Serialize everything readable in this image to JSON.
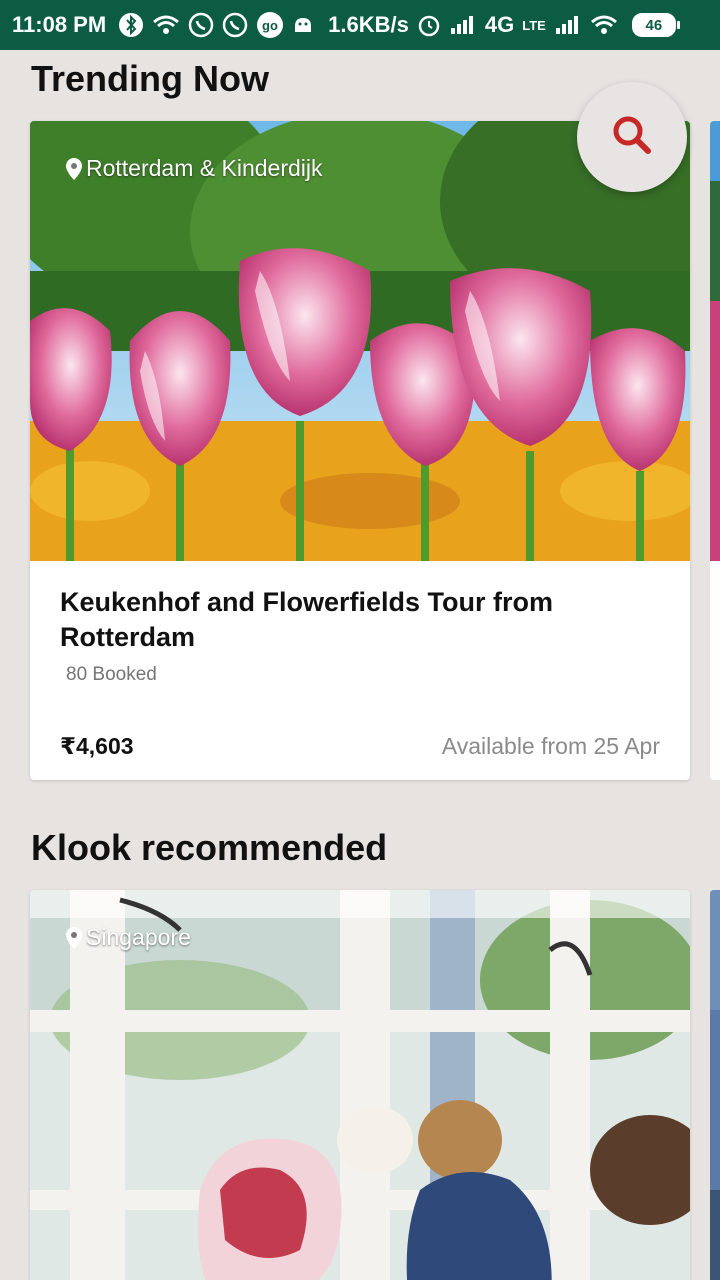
{
  "status_bar": {
    "time": "11:08 PM",
    "speed": "1.6KB/s",
    "network": "4G",
    "volte": "LTE",
    "battery": "46",
    "icons": [
      "bluetooth-icon",
      "wifi-icon",
      "whatsapp-icon",
      "whatsapp-icon",
      "go-icon",
      "android-icon",
      "alarm-icon",
      "signal-icon",
      "signal-icon",
      "wifi-icon"
    ]
  },
  "fab": {
    "icon": "search-icon",
    "color": "#c62828"
  },
  "sections": {
    "trending": {
      "title": "Trending Now",
      "card": {
        "location": "Rotterdam & Kinderdijk",
        "title": "Keukenhof and Flowerfields Tour from Rotterdam",
        "booked": "80 Booked",
        "price": "₹4,603",
        "availability": "Available from 25 Apr"
      }
    },
    "recommended": {
      "title": "Klook recommended",
      "card": {
        "location": "Singapore"
      }
    }
  },
  "colors": {
    "status_bar": "#0c5c43",
    "background": "#e6e3e1",
    "accent": "#c62828"
  }
}
